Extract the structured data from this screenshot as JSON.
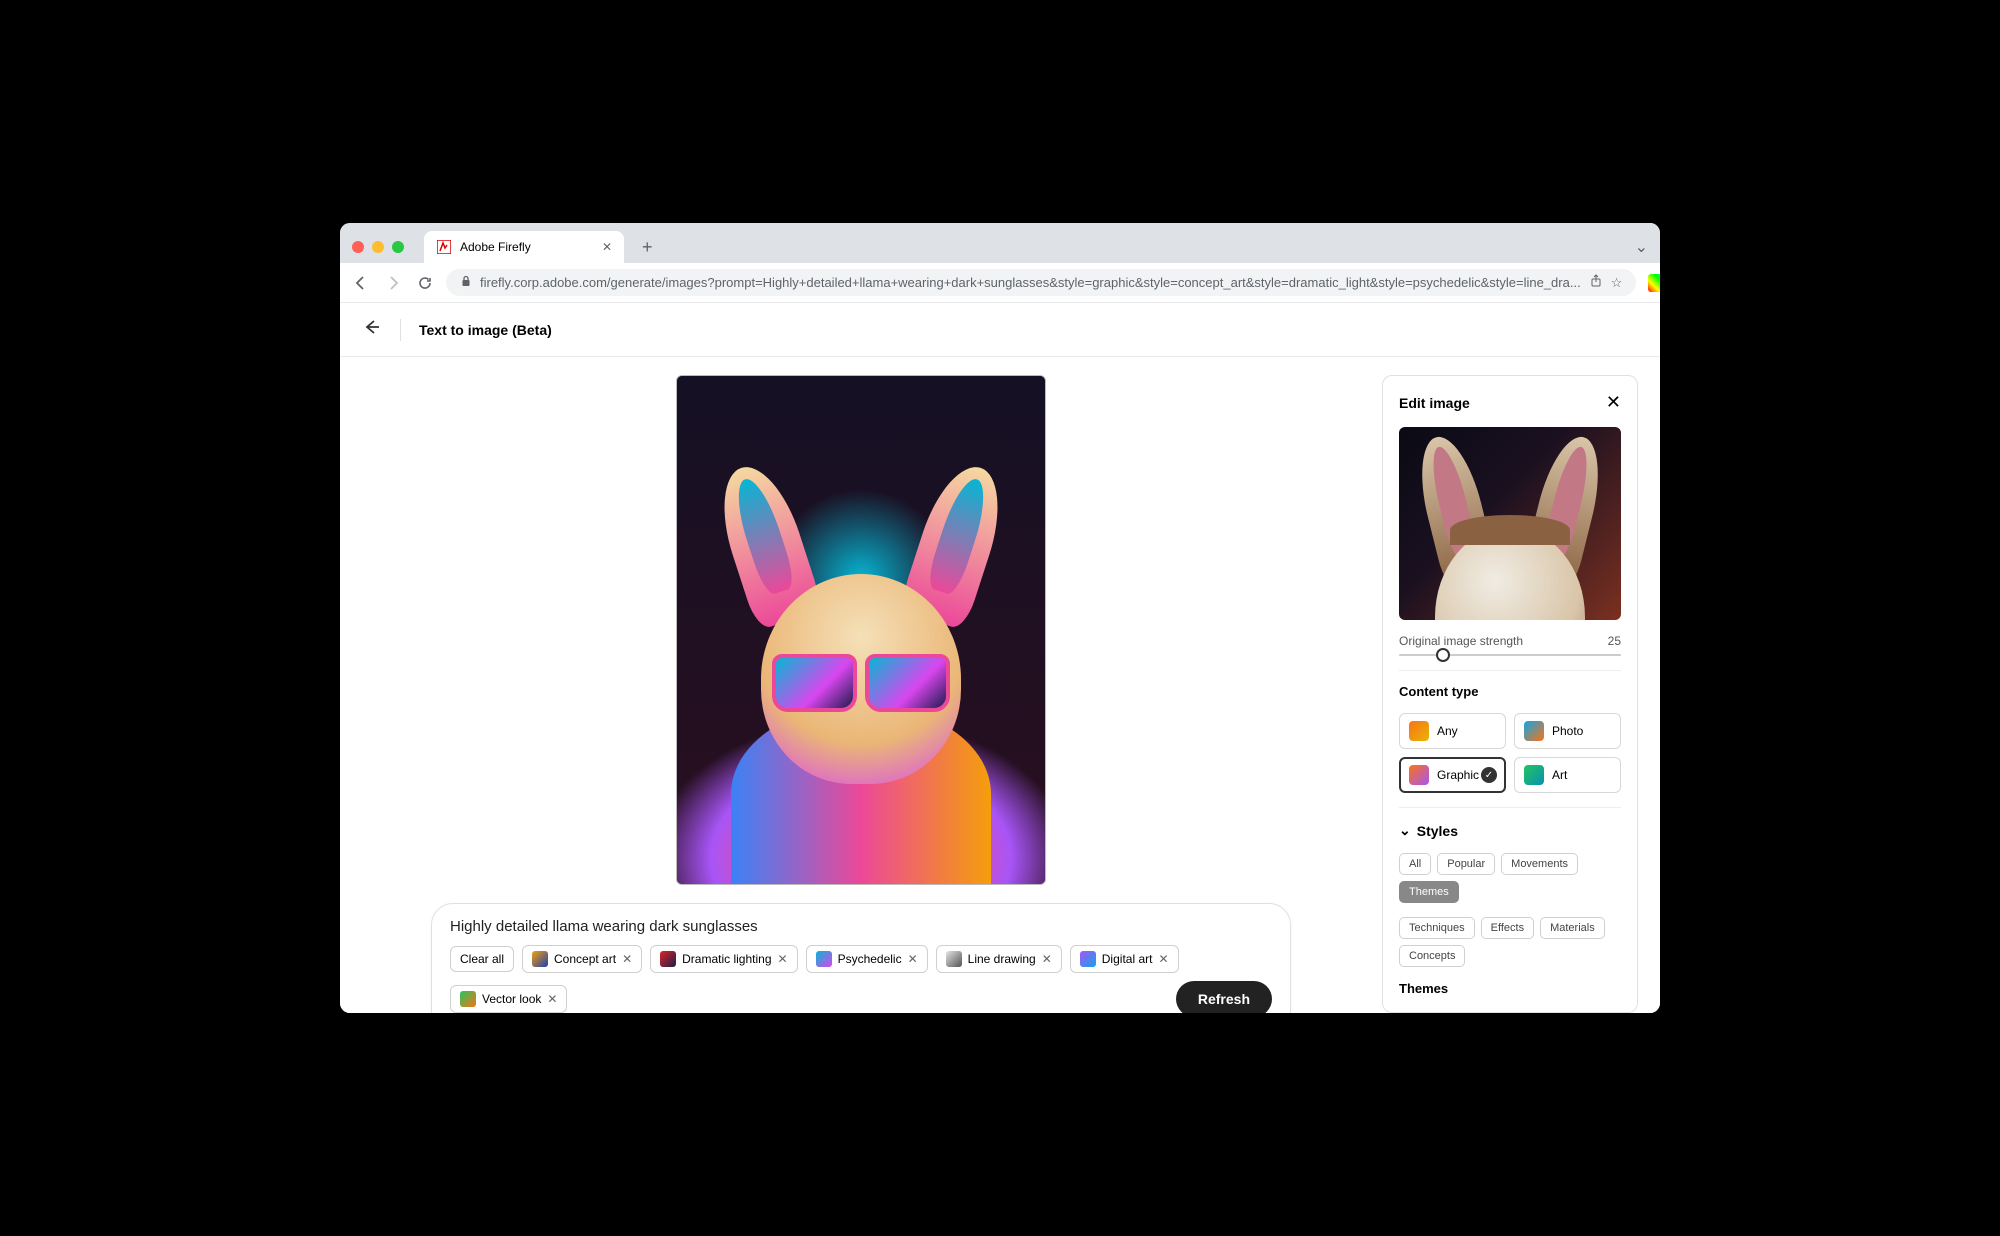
{
  "browser": {
    "tab_title": "Adobe Firefly",
    "url": "firefly.corp.adobe.com/generate/images?prompt=Highly+detailed+llama+wearing+dark+sunglasses&style=graphic&style=concept_art&style=dramatic_light&style=psychedelic&style=line_dra..."
  },
  "header": {
    "page_title": "Text to image (Beta)"
  },
  "prompt": {
    "text": "Highly detailed llama wearing dark sunglasses",
    "clear_all": "Clear all",
    "refresh": "Refresh",
    "chips": [
      {
        "label": "Concept art",
        "swatch": "linear-gradient(135deg,#f59e0b,#1e40af)"
      },
      {
        "label": "Dramatic lighting",
        "swatch": "linear-gradient(135deg,#dc2626,#1e1b4b)"
      },
      {
        "label": "Psychedelic",
        "swatch": "linear-gradient(135deg,#06b6d4,#d946ef)"
      },
      {
        "label": "Line drawing",
        "swatch": "linear-gradient(135deg,#e5e5e5,#525252)"
      },
      {
        "label": "Digital art",
        "swatch": "linear-gradient(135deg,#a855f7,#0ea5e9)"
      },
      {
        "label": "Vector look",
        "swatch": "linear-gradient(135deg,#22c55e,#f97316)"
      }
    ]
  },
  "panel": {
    "title": "Edit image",
    "strength_label": "Original image strength",
    "strength_value": "25",
    "content_type_title": "Content type",
    "content_types": [
      {
        "label": "Any",
        "swatch": "linear-gradient(135deg,#f97316,#eab308)",
        "selected": false
      },
      {
        "label": "Photo",
        "swatch": "linear-gradient(135deg,#0ea5e9,#f97316)",
        "selected": false
      },
      {
        "label": "Graphic",
        "swatch": "linear-gradient(135deg,#f97316,#a855f7)",
        "selected": true
      },
      {
        "label": "Art",
        "swatch": "linear-gradient(135deg,#22c55e,#0891b2)",
        "selected": false
      }
    ],
    "styles_title": "Styles",
    "style_tabs_1": [
      "All",
      "Popular",
      "Movements",
      "Themes"
    ],
    "style_tabs_2": [
      "Techniques",
      "Effects",
      "Materials",
      "Concepts"
    ],
    "active_tab": "Themes",
    "themes_label": "Themes"
  }
}
